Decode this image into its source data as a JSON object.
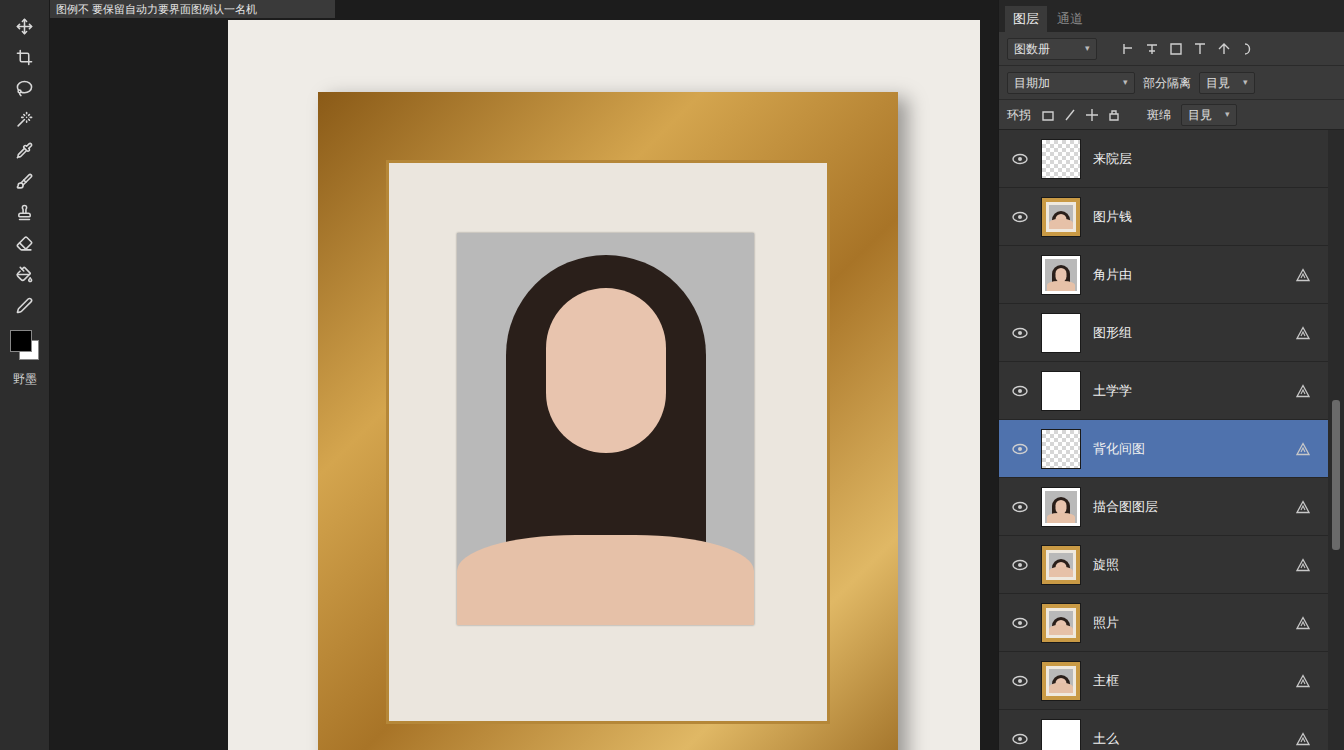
{
  "window": {
    "title": "图例不 要保留自动力要界面图例认一名机"
  },
  "toolbar": {
    "label": "野墨"
  },
  "layers_panel": {
    "tabs": [
      {
        "label": "图层",
        "selected": true
      },
      {
        "label": "通道",
        "selected": false
      }
    ],
    "filter": "图数册",
    "blend_mode": "目期加",
    "opacity_label": "部分隔离",
    "opacity": "目見",
    "lock_label": "环拐",
    "fill_label": "斑绵",
    "fill": "目見",
    "layers": [
      {
        "name": "来院层",
        "visible": true,
        "locked": false,
        "selected": false,
        "kind": "transparent"
      },
      {
        "name": "图片钱",
        "visible": true,
        "locked": false,
        "selected": false,
        "kind": "framed"
      },
      {
        "name": "角片由",
        "visible": false,
        "locked": true,
        "selected": false,
        "kind": "portrait"
      },
      {
        "name": "图形组",
        "visible": true,
        "locked": true,
        "selected": false,
        "kind": "white"
      },
      {
        "name": "土学学",
        "visible": true,
        "locked": true,
        "selected": false,
        "kind": "white"
      },
      {
        "name": "背化间图",
        "visible": true,
        "locked": true,
        "selected": true,
        "kind": "transparent"
      },
      {
        "name": "描合图图层",
        "visible": true,
        "locked": true,
        "selected": false,
        "kind": "portrait"
      },
      {
        "name": "旋照",
        "visible": true,
        "locked": true,
        "selected": false,
        "kind": "framed"
      },
      {
        "name": "照片",
        "visible": true,
        "locked": true,
        "selected": false,
        "kind": "framed"
      },
      {
        "name": "主框",
        "visible": true,
        "locked": true,
        "selected": false,
        "kind": "framed"
      },
      {
        "name": "土么",
        "visible": true,
        "locked": true,
        "selected": false,
        "kind": "white"
      }
    ]
  }
}
